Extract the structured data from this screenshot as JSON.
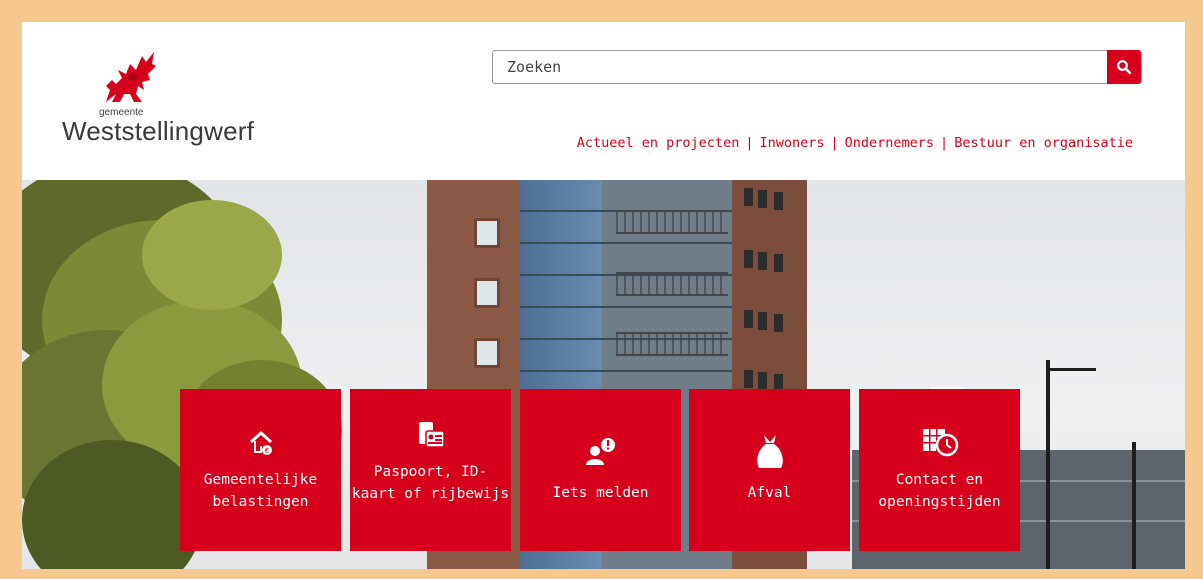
{
  "logo": {
    "small": "gemeente",
    "name": "Weststellingwerf"
  },
  "search": {
    "placeholder": "Zoeken",
    "icon": "search-icon"
  },
  "topnav": {
    "items": [
      "Actueel en projecten",
      "Inwoners",
      "Ondernemers",
      "Bestuur en organisatie"
    ],
    "separator": "|"
  },
  "tiles": [
    {
      "label": "Gemeentelijke\nbelastingen",
      "icon": "house-tax-icon"
    },
    {
      "label": "Paspoort, ID-\nkaart of rijbewijs",
      "icon": "id-card-icon"
    },
    {
      "label": "Iets melden",
      "icon": "report-person-icon"
    },
    {
      "label": "Afval",
      "icon": "waste-bag-icon"
    },
    {
      "label": "Contact en\nopeningstijden",
      "icon": "calendar-clock-icon"
    }
  ],
  "colors": {
    "brand_red": "#d7001c",
    "frame": "#f5c98e",
    "arrow": "#6b1f6e"
  }
}
